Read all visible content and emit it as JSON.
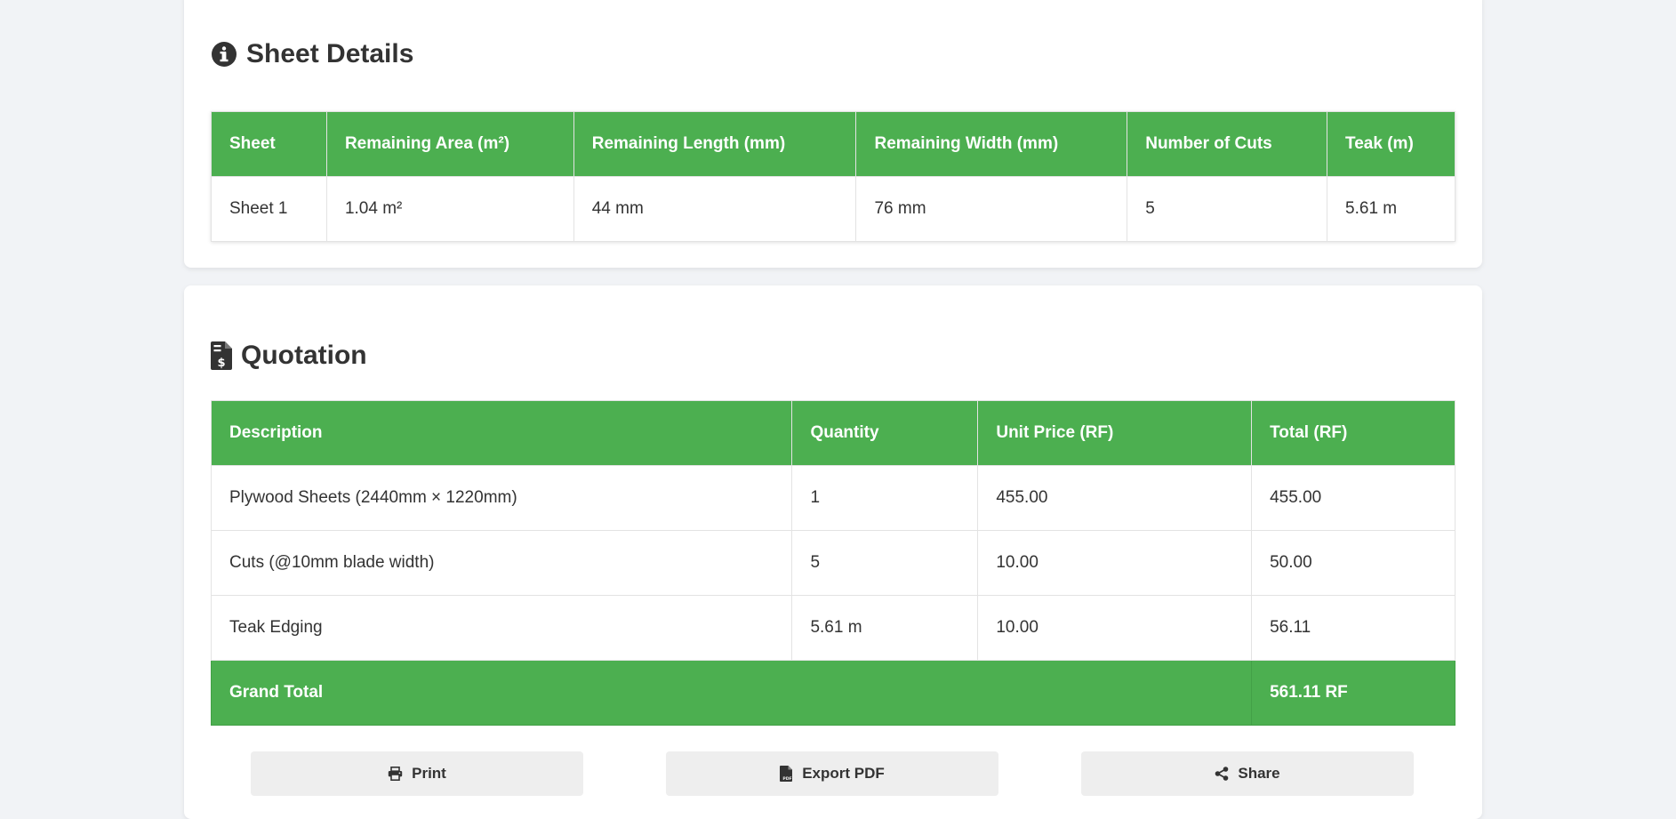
{
  "sheet_details": {
    "title": "Sheet Details",
    "icon": "info-circle-icon",
    "columns": [
      "Sheet",
      "Remaining Area (m²)",
      "Remaining Length (mm)",
      "Remaining Width (mm)",
      "Number of Cuts",
      "Teak (m)"
    ],
    "rows": [
      [
        "Sheet 1",
        "1.04 m²",
        "44 mm",
        "76 mm",
        "5",
        "5.61 m"
      ]
    ]
  },
  "quotation": {
    "title": "Quotation",
    "icon": "invoice-dollar-icon",
    "columns": [
      "Description",
      "Quantity",
      "Unit Price (RF)",
      "Total (RF)"
    ],
    "rows": [
      [
        "Plywood Sheets (2440mm × 1220mm)",
        "1",
        "455.00",
        "455.00"
      ],
      [
        "Cuts (@10mm blade width)",
        "5",
        "10.00",
        "50.00"
      ],
      [
        "Teak Edging",
        "5.61 m",
        "10.00",
        "56.11"
      ]
    ],
    "grand_total_label": "Grand Total",
    "grand_total_value": "561.11 RF"
  },
  "actions": {
    "print_label": "Print",
    "export_pdf_label": "Export PDF",
    "share_label": "Share"
  },
  "colors": {
    "accent": "#4caf50",
    "background": "#f1f3f6",
    "button_bg": "#eeeeee",
    "text": "#333333"
  }
}
